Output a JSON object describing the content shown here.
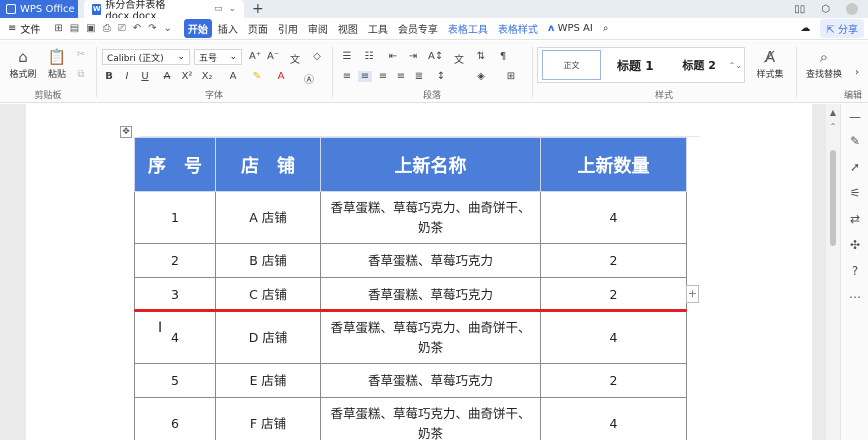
{
  "titlebar": {
    "app_tab": "WPS Office",
    "doc_tab": "拆分合并表格docx.docx"
  },
  "menubar": {
    "file_label": "文件",
    "tabs": [
      "开始",
      "插入",
      "页面",
      "引用",
      "审阅",
      "视图",
      "工具",
      "会员专享"
    ],
    "context_tabs": [
      "表格工具",
      "表格样式"
    ],
    "ai_label": "WPS AI",
    "share_label": "分享"
  },
  "ribbon": {
    "format_painter": "格式刷",
    "paste": "粘贴",
    "clipboard_group": "剪贴板",
    "font_name": "Calibri (正文)",
    "font_size": "五号",
    "font_group": "字体",
    "paragraph_group": "段落",
    "styles": {
      "normal": "正文",
      "heading1": "标题 1",
      "heading2": "标题 2"
    },
    "style_set": "样式集",
    "style_group": "样式",
    "find_replace": "查找替换",
    "edit_group": "编辑"
  },
  "table": {
    "headers": [
      "序　号",
      "店　铺",
      "上新名称",
      "上新数量"
    ],
    "rows": [
      [
        "1",
        "A 店铺",
        "香草蛋糕、草莓巧克力、曲奇饼干、奶茶",
        "4"
      ],
      [
        "2",
        "B 店铺",
        "香草蛋糕、草莓巧克力",
        "2"
      ],
      [
        "3",
        "C 店铺",
        "香草蛋糕、草莓巧克力",
        "2"
      ],
      [
        "4",
        "D 店铺",
        "香草蛋糕、草莓巧克力、曲奇饼干、奶茶",
        "4"
      ],
      [
        "5",
        "E 店铺",
        "香草蛋糕、草莓巧克力",
        "2"
      ],
      [
        "6",
        "F 店铺",
        "香草蛋糕、草莓巧克力、曲奇饼干、奶茶",
        "4"
      ]
    ]
  },
  "colors": {
    "accent": "#3a6fde",
    "header_fill": "#4a7ed8",
    "split_line": "#e02020"
  }
}
